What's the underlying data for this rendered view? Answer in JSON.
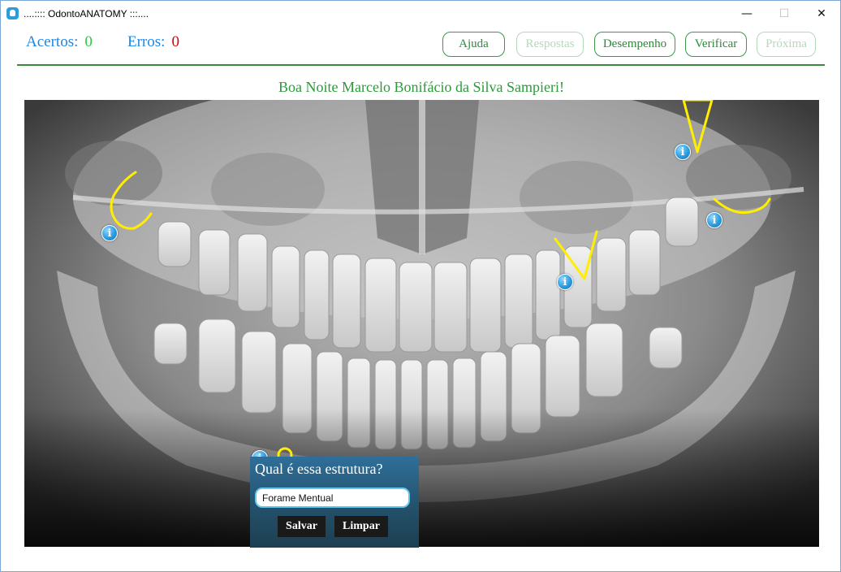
{
  "window": {
    "title": "....:::: OdontoANATOMY :::....",
    "minimize_glyph": "—",
    "maximize_glyph": "☐",
    "close_glyph": "✕"
  },
  "score": {
    "acertos_label": "Acertos:",
    "acertos_value": "0",
    "erros_label": "Erros:",
    "erros_value": "0"
  },
  "toolbar": {
    "ajuda": "Ajuda",
    "respostas": "Respostas",
    "desempenho": "Desempenho",
    "verificar": "Verificar",
    "proxima": "Próxima"
  },
  "greeting": "Boa Noite Marcelo Bonifácio da Silva Sampieri!",
  "info_glyph": "i",
  "dialog": {
    "title": "Qual é essa estrutura?",
    "input_value": "Forame Mentual",
    "save": "Salvar",
    "clear": "Limpar"
  },
  "colors": {
    "accent_green": "#2c8a3a",
    "score_blue": "#1e88e5",
    "annotation_yellow": "#ffee00"
  }
}
